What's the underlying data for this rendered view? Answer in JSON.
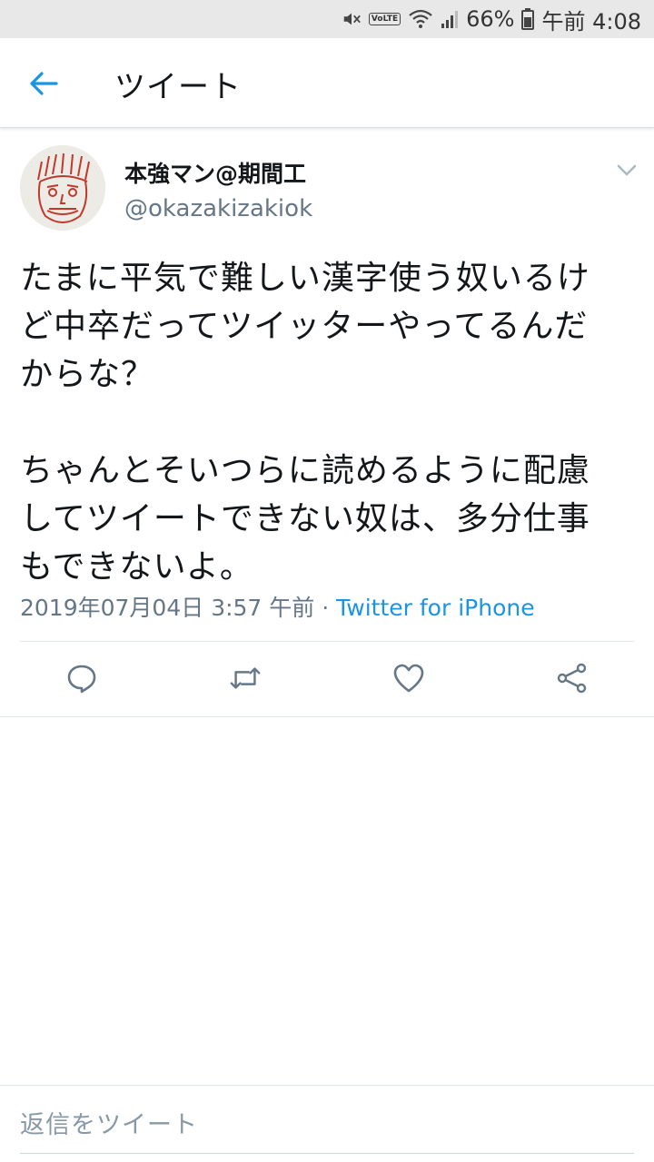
{
  "status_bar": {
    "volte_label": "VoLTE",
    "battery_percent": "66%",
    "time": "午前 4:08"
  },
  "header": {
    "title": "ツイート"
  },
  "tweet": {
    "display_name": "本強マン@期間工",
    "handle": "@okazakizakiok",
    "paragraphs": [
      [
        "たまに平気で難しい漢字使う奴いるけ",
        "ど中卒だってツイッターやってるんだ",
        "からな？"
      ],
      [
        "ちゃんとそいつらに読めるように配慮",
        "してツイートできない奴は、多分仕事",
        "もできないよ。"
      ]
    ],
    "timestamp": "2019年07月04日 3:57 午前",
    "separator": "·",
    "source": "Twitter for iPhone"
  },
  "actions": [
    "reply-icon",
    "retweet-icon",
    "like-icon",
    "share-icon"
  ],
  "reply": {
    "placeholder": "返信をツイート"
  },
  "colors": {
    "accent": "#1b95e0",
    "secondary_text": "#657786",
    "status_bar_bg": "#e8e8e8"
  }
}
